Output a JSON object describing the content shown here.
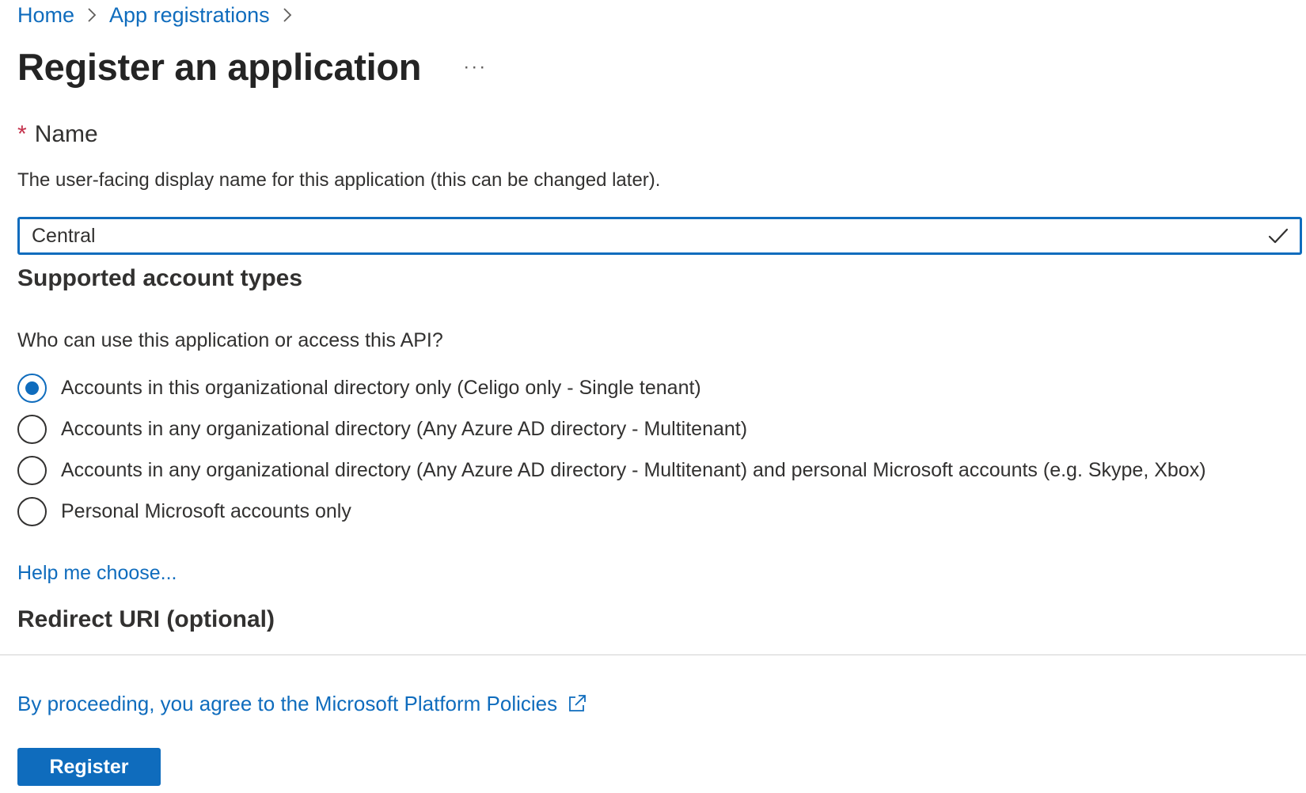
{
  "breadcrumb": {
    "items": [
      {
        "label": "Home"
      },
      {
        "label": "App registrations"
      }
    ]
  },
  "page": {
    "title": "Register an application",
    "more_label": "···"
  },
  "name_section": {
    "required_mark": "*",
    "label": "Name",
    "description": "The user-facing display name for this application (this can be changed later).",
    "input_value": "Central",
    "validation_icon": "checkmark-icon"
  },
  "account_types": {
    "heading": "Supported account types",
    "question": "Who can use this application or access this API?",
    "options": [
      {
        "label": "Accounts in this organizational directory only (Celigo only - Single tenant)",
        "selected": true
      },
      {
        "label": "Accounts in any organizational directory (Any Azure AD directory - Multitenant)",
        "selected": false
      },
      {
        "label": "Accounts in any organizational directory (Any Azure AD directory - Multitenant) and personal Microsoft accounts (e.g. Skype, Xbox)",
        "selected": false
      },
      {
        "label": "Personal Microsoft accounts only",
        "selected": false
      }
    ],
    "help_link": "Help me choose..."
  },
  "redirect": {
    "heading": "Redirect URI (optional)"
  },
  "footer": {
    "policy_link": "By proceeding, you agree to the Microsoft Platform Policies",
    "policy_icon": "external-link-icon",
    "register_label": "Register"
  },
  "colors": {
    "accent": "#0f6cbd",
    "required": "#c4314b",
    "text": "#323130"
  }
}
